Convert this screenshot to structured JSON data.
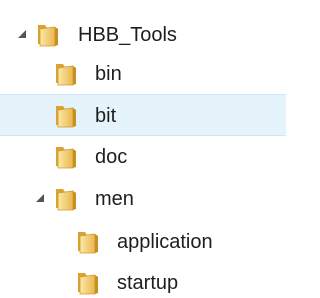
{
  "tree": {
    "nodes": [
      {
        "name": "HBB_Tools",
        "expanded": true,
        "hover": false,
        "depth": 0
      },
      {
        "name": "bin",
        "expanded": null,
        "hover": false,
        "depth": 1
      },
      {
        "name": "bit",
        "expanded": null,
        "hover": true,
        "depth": 1
      },
      {
        "name": "doc",
        "expanded": null,
        "hover": false,
        "depth": 1
      },
      {
        "name": "men",
        "expanded": true,
        "hover": false,
        "depth": 1
      },
      {
        "name": "application",
        "expanded": null,
        "hover": false,
        "depth": 2
      },
      {
        "name": "startup",
        "expanded": null,
        "hover": false,
        "depth": 2
      }
    ]
  },
  "icons": {
    "folder": "folder-icon",
    "expanded_arrow": "expanded-arrow-icon"
  },
  "colors": {
    "hover_background": "#e5f3fb",
    "text": "#1e1e1e",
    "folder_front": "#f6d27a",
    "folder_back": "#e2ad3c"
  }
}
